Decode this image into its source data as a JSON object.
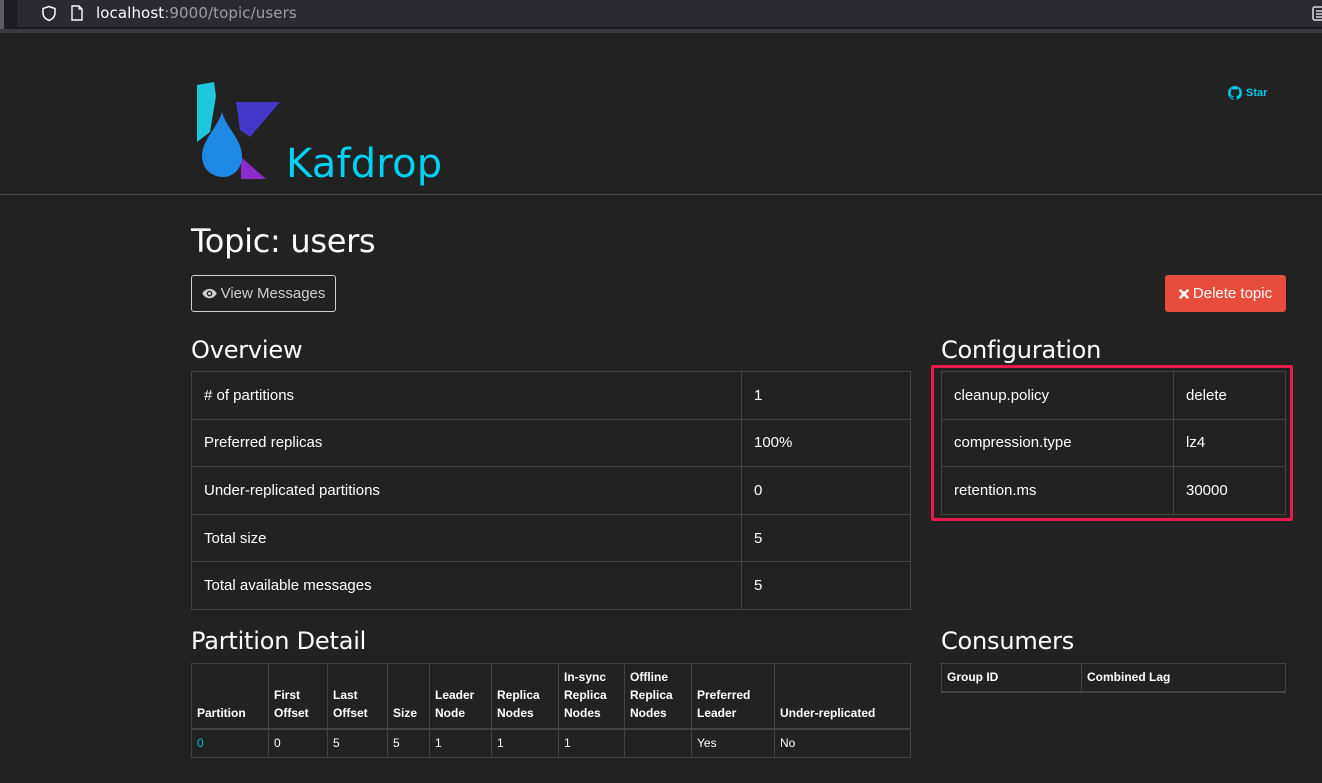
{
  "browser": {
    "url_host": "localhost",
    "url_rest": ":9000/topic/users"
  },
  "header": {
    "brand": "Kafdrop",
    "star_label": "Star"
  },
  "page": {
    "title": "Topic: users",
    "view_messages_label": "View Messages",
    "delete_topic_label": "Delete topic"
  },
  "overview": {
    "heading": "Overview",
    "rows": [
      {
        "label": "# of partitions",
        "value": "1"
      },
      {
        "label": "Preferred replicas",
        "value": "100%"
      },
      {
        "label": "Under-replicated partitions",
        "value": "0"
      },
      {
        "label": "Total size",
        "value": "5"
      },
      {
        "label": "Total available messages",
        "value": "5"
      }
    ]
  },
  "configuration": {
    "heading": "Configuration",
    "rows": [
      {
        "key": "cleanup.policy",
        "value": "delete"
      },
      {
        "key": "compression.type",
        "value": "lz4"
      },
      {
        "key": "retention.ms",
        "value": "30000"
      }
    ]
  },
  "partition_detail": {
    "heading": "Partition Detail",
    "columns": [
      "Partition",
      "First Offset",
      "Last Offset",
      "Size",
      "Leader Node",
      "Replica Nodes",
      "In-sync Replica Nodes",
      "Offline Replica Nodes",
      "Preferred Leader",
      "Under-replicated"
    ],
    "rows": [
      [
        "0",
        "0",
        "5",
        "5",
        "1",
        "1",
        "1",
        "",
        "Yes",
        "No"
      ]
    ]
  },
  "consumers": {
    "heading": "Consumers",
    "columns": [
      "Group ID",
      "Combined Lag"
    ]
  },
  "colors": {
    "background": "#222222",
    "brand": "#00d1f1",
    "danger": "#e74c3c",
    "highlight": "#e8194b",
    "link": "#00bcd4"
  }
}
